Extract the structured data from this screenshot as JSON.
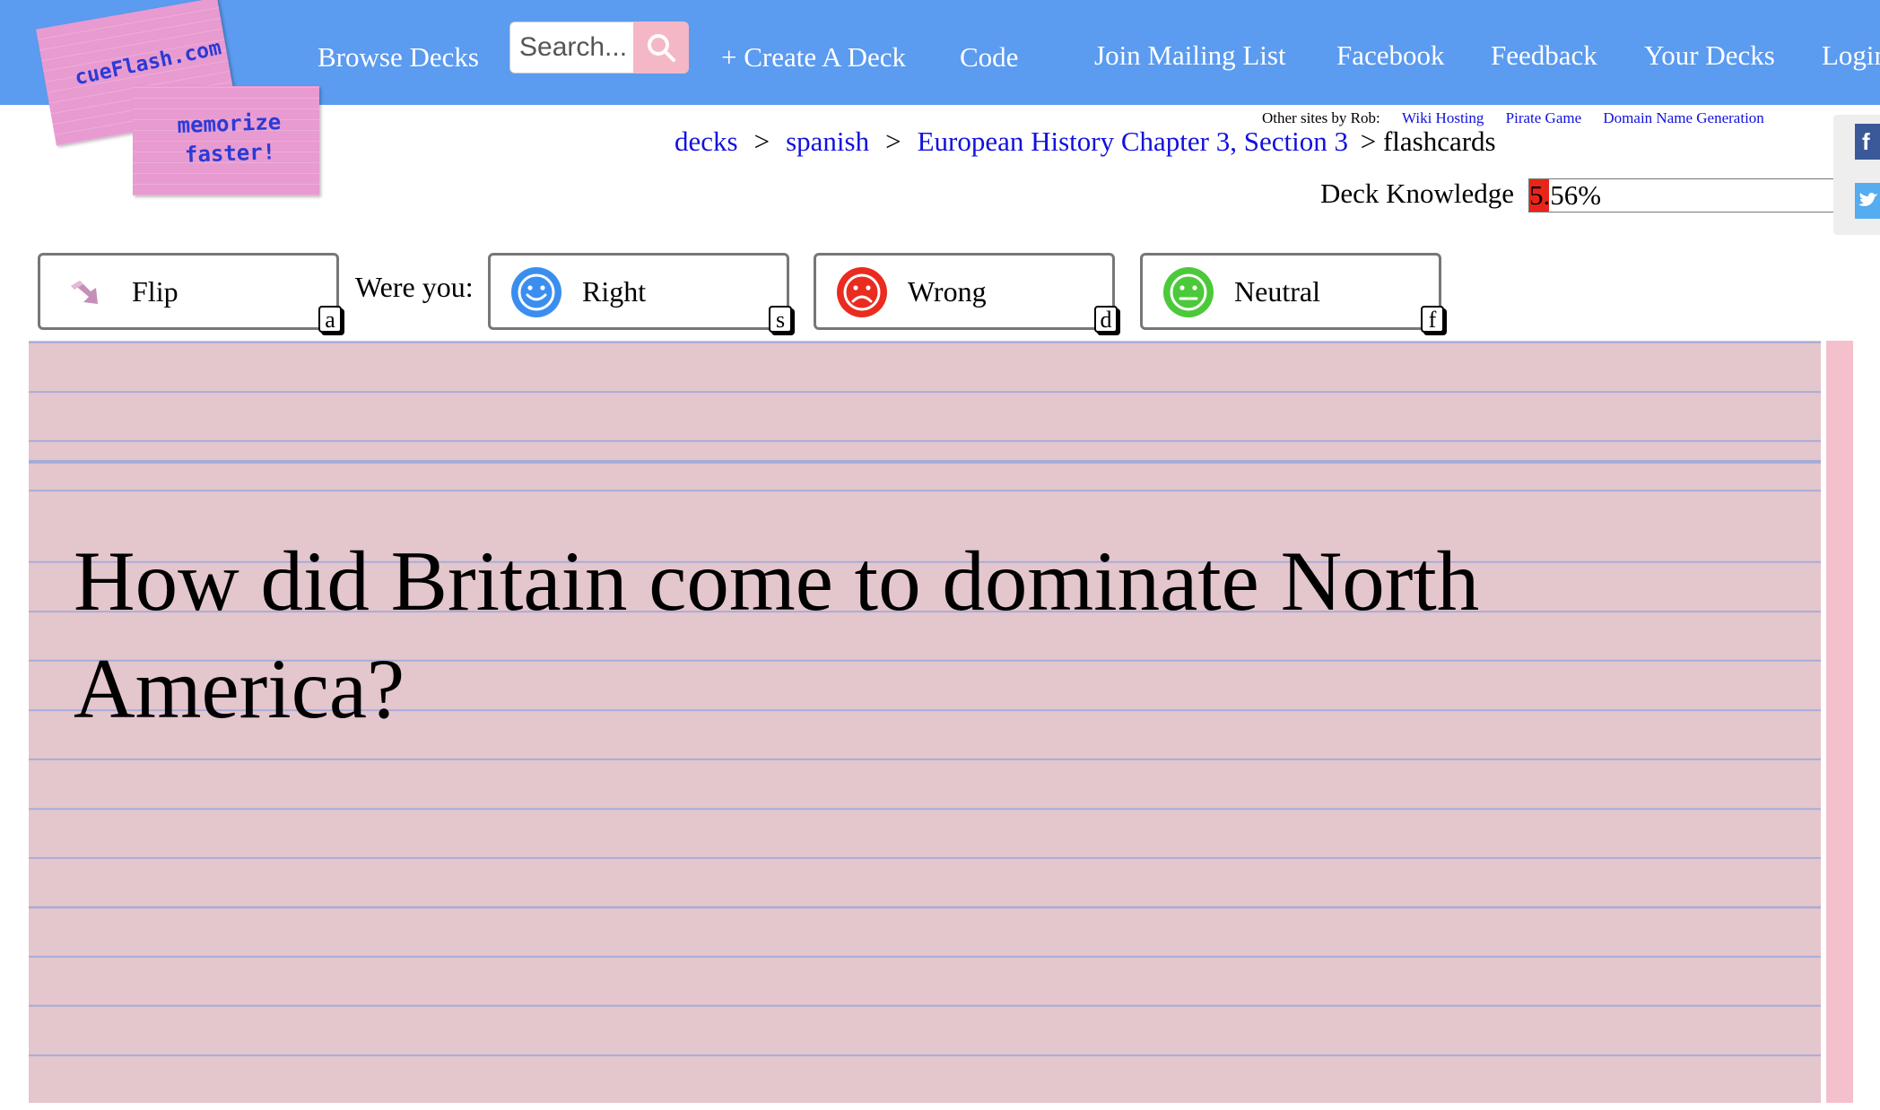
{
  "logo": {
    "line1": "cueFlash.com",
    "line2": "memorize",
    "line3": "faster!"
  },
  "nav": {
    "browse": "Browse Decks",
    "search_placeholder": "Search...",
    "create": "+ Create A Deck",
    "code": "Code",
    "mailing": "Join Mailing List",
    "facebook": "Facebook",
    "feedback": "Feedback",
    "your_decks": "Your Decks",
    "login": "Login"
  },
  "other_sites": {
    "label": "Other sites by Rob:",
    "links": [
      "Wiki Hosting",
      "Pirate Game",
      "Domain Name Generation"
    ]
  },
  "breadcrumb": {
    "items": [
      "decks",
      "spanish",
      "European History Chapter 3, Section 3"
    ],
    "separator": ">",
    "current": "> flashcards"
  },
  "knowledge": {
    "label": "Deck Knowledge",
    "value_text": "5.56%",
    "fraction": 0.0556,
    "fill_color": "#e8251b"
  },
  "social": {
    "icons": [
      "facebook-icon",
      "twitter-icon"
    ]
  },
  "controls": {
    "flip": {
      "label": "Flip",
      "key": "a"
    },
    "were_you": "Were you:",
    "right": {
      "label": "Right",
      "key": "s",
      "color": "#3b8ef0"
    },
    "wrong": {
      "label": "Wrong",
      "key": "d",
      "color": "#ea2b1f"
    },
    "neutral": {
      "label": "Neutral",
      "key": "f",
      "color": "#4cc93a"
    }
  },
  "card": {
    "text": "How did Britain come to dominate North America?"
  },
  "colors": {
    "topbar": "#5b9bf0",
    "card": "#e4c6cd",
    "link": "#1111dd"
  }
}
